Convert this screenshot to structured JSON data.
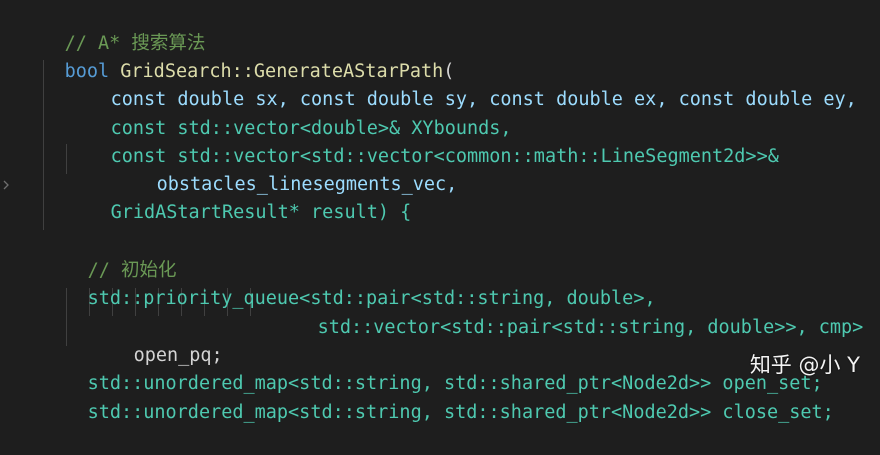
{
  "code": {
    "line1": {
      "comment": "// A* 搜索算法"
    },
    "line2": {
      "kw_bool": "bool",
      "fn": "GridSearch::GenerateAStarPath",
      "paren": "("
    },
    "line3": {
      "text": "const double sx, const double sy, const double ex, const double ey,"
    },
    "line4": {
      "text": "const std::vector<double>& XYbounds,"
    },
    "line5": {
      "text": "const std::vector<std::vector<common::math::LineSegment2d>>&"
    },
    "line6": {
      "text": "obstacles_linesegments_vec,"
    },
    "line7": {
      "text": "GridAStartResult* result) {"
    },
    "line8": {
      "comment": "// 初始化"
    },
    "line9": {
      "text": "std::priority_queue<std::pair<std::string, double>,"
    },
    "line10": {
      "text": "std::vector<std::pair<std::string, double>>, cmp>"
    },
    "line11": {
      "text": "open_pq;"
    },
    "line12": {
      "text": "std::unordered_map<std::string, std::shared_ptr<Node2d>> open_set;"
    },
    "line13": {
      "text": "std::unordered_map<std::string, std::shared_ptr<Node2d>> close_set;"
    }
  },
  "watermark": {
    "text": "知乎 @小 Y"
  },
  "colors": {
    "background": "#1e1e1e",
    "comment": "#6a9955",
    "keyword": "#569cd6",
    "type": "#4ec9b0",
    "function": "#dcdcaa",
    "variable": "#9cdcfe"
  }
}
